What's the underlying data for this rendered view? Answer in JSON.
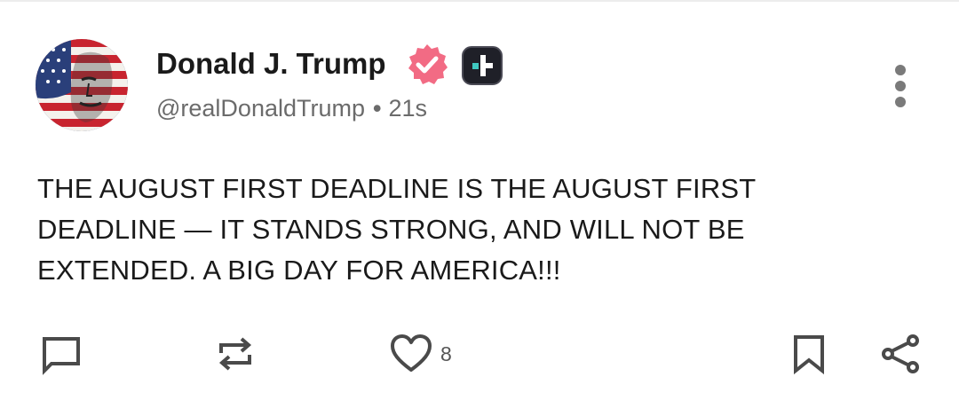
{
  "author": {
    "display_name": "Donald J. Trump",
    "handle": "@realDonaldTrump",
    "separator": "•",
    "time_ago": "21s",
    "verified_color": "#f26b84"
  },
  "post": {
    "text": "THE AUGUST FIRST DEADLINE IS THE AUGUST FIRST DEADLINE — IT STANDS STRONG, AND WILL NOT BE EXTENDED. A BIG DAY FOR AMERICA!!!"
  },
  "actions": {
    "reply_icon": "comment-icon",
    "repost_icon": "repost-icon",
    "like_icon": "heart-icon",
    "like_count": "8",
    "bookmark_icon": "bookmark-icon",
    "share_icon": "share-icon",
    "more_icon": "vertical-ellipsis-icon"
  }
}
